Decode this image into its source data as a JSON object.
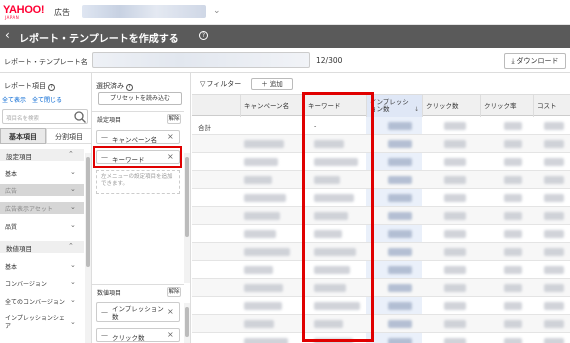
{
  "header": {
    "logo_text": "YAHOO!",
    "logo_sub": "JAPAN",
    "logo_ad": "広告"
  },
  "titlebar": {
    "title": "レポート・テンプレートを作成する",
    "help": "?"
  },
  "template": {
    "name_label": "レポート・テンプレート名",
    "count": "12/300",
    "download_label": "ダウンロード"
  },
  "left_panel": {
    "heading": "レポート項目",
    "help": "?",
    "open_all": "全て表示",
    "close_all": "全て閉じる",
    "search_placeholder": "項目名を検索",
    "tabs": [
      "基本項目",
      "分割項目"
    ],
    "categories": [
      {
        "label": "設定項目",
        "items": [
          {
            "label": "基本",
            "disabled": false
          },
          {
            "label": "広告",
            "disabled": true
          },
          {
            "label": "広告表示アセット",
            "disabled": true
          },
          {
            "label": "品質",
            "disabled": false
          }
        ]
      },
      {
        "label": "数値項目",
        "items": [
          {
            "label": "基本",
            "disabled": false
          },
          {
            "label": "コンバージョン",
            "disabled": false
          },
          {
            "label": "全てのコンバージョン",
            "disabled": false
          },
          {
            "label": "インプレッションシェア",
            "disabled": false
          },
          {
            "label": "",
            "disabled": false
          }
        ]
      }
    ]
  },
  "selected_panel": {
    "heading": "選択済み",
    "help": "?",
    "preset_button": "プリセットを読み込む",
    "settings_section": "設定項目",
    "numeric_section": "数値項目",
    "clear_label": "解除",
    "settings_chips": [
      "キャンペーン名",
      "キーワード"
    ],
    "drop_hint": "左メニューの設定項目を追加できます。",
    "numeric_chips": [
      "インプレッション数",
      "クリック数"
    ]
  },
  "table": {
    "filter_label": "フィルター",
    "add_label": "追加",
    "columns": [
      "キャンペーン名",
      "キーワード",
      "インプレッション数",
      "クリック数",
      "クリック率",
      "コスト"
    ],
    "total_row_label": "合計",
    "total_keyword": "-",
    "sorted_column": "インプレッション数",
    "row_count": 13
  },
  "colors": {
    "brand": "#ff0033",
    "titlebar": "#5a5a5a",
    "highlight": "#e00000",
    "link": "#0064d2"
  }
}
